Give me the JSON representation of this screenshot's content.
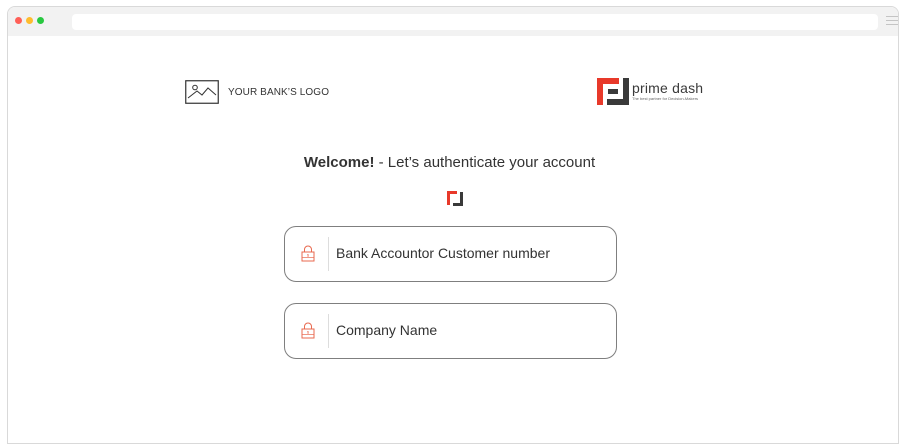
{
  "bank_logo": {
    "label": "YOUR BANK’S LOGO",
    "icon": "image-placeholder-icon"
  },
  "brand": {
    "name": "prime dash",
    "tagline": "The best partner for Decision-Makers",
    "icon": "prime-dash-logo-icon",
    "colors": {
      "red": "#e8392a",
      "dark": "#3a3a3a"
    }
  },
  "welcome": {
    "bold": "Welcome!",
    "rest": " - Let’s authenticate your account"
  },
  "form": {
    "fields": [
      {
        "label": "Bank Accountor Customer number",
        "icon": "lock-icon"
      },
      {
        "label": "Company Name",
        "icon": "lock-icon"
      }
    ]
  },
  "colors": {
    "traffic_red": "#ff5f57",
    "traffic_yellow": "#febc2e",
    "traffic_green": "#28c840",
    "field_icon": "#e8694f"
  }
}
